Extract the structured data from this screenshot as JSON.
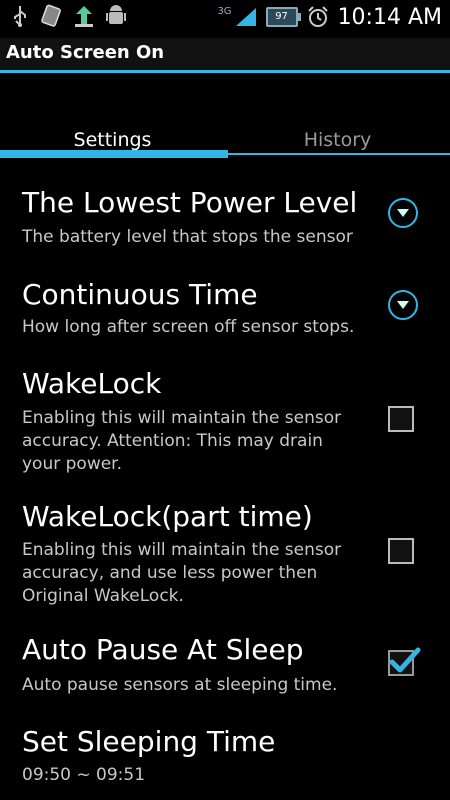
{
  "status_bar": {
    "network_type": "3G",
    "battery_level": "97",
    "time": "10:14 AM",
    "icons": [
      "usb-icon",
      "app-icon",
      "upload-icon",
      "android-debug-icon",
      "signal-icon",
      "battery-icon",
      "alarm-icon"
    ]
  },
  "app": {
    "title": "Auto Screen On"
  },
  "tabs": [
    {
      "label": "Settings",
      "active": true
    },
    {
      "label": "History",
      "active": false
    }
  ],
  "settings": [
    {
      "title": "The Lowest Power Level",
      "summary": "The battery level that stops the sensor",
      "control": "dropdown"
    },
    {
      "title": "Continuous Time",
      "summary": "How long after screen off sensor stops.",
      "control": "dropdown"
    },
    {
      "title": "WakeLock",
      "summary": "Enabling this will maintain the sensor accuracy. Attention: This may drain your power.",
      "control": "checkbox",
      "checked": false
    },
    {
      "title": "WakeLock(part time)",
      "summary": "Enabling this will maintain the sensor accuracy, and use less power then Original WakeLock.",
      "control": "checkbox",
      "checked": false
    },
    {
      "title": "Auto Pause At Sleep",
      "summary": "Auto pause sensors at sleeping time.",
      "control": "checkbox",
      "checked": true
    },
    {
      "title": "Set Sleeping Time",
      "summary": "09:50 ~ 09:51",
      "control": "none"
    }
  ],
  "colors": {
    "accent": "#33b5e5",
    "background": "#000000",
    "summary_text": "#c8c8c8"
  }
}
